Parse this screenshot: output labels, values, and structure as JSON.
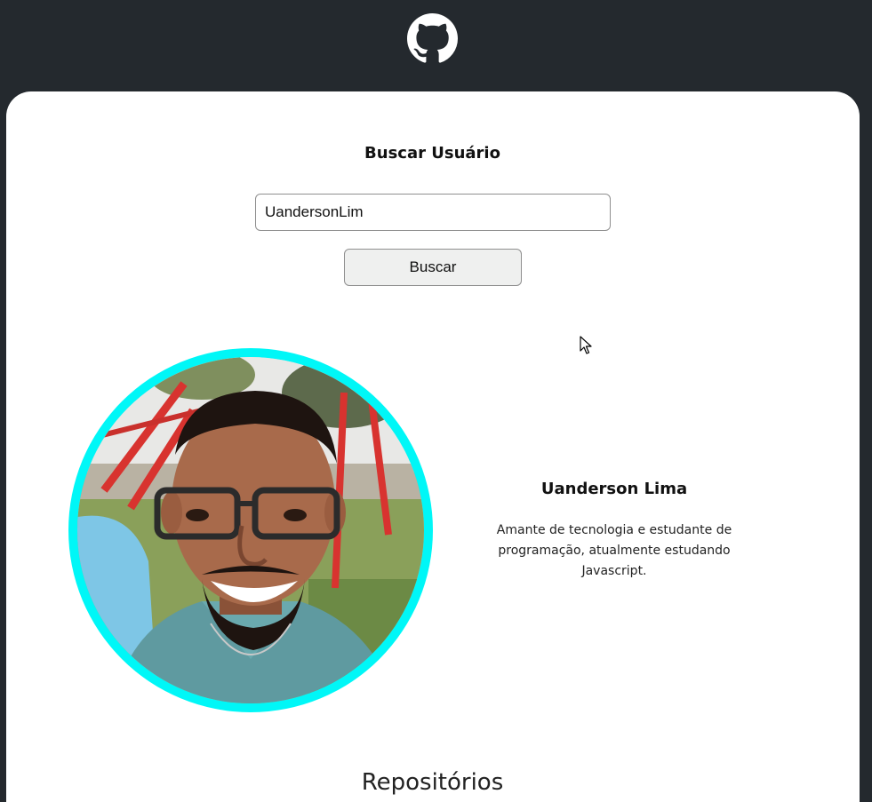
{
  "header": {
    "logo_icon": "github-icon",
    "background": "#24292e"
  },
  "search": {
    "title": "Buscar Usuário",
    "input_value": "UandersonLim",
    "button_label": "Buscar"
  },
  "profile": {
    "avatar_icon": "user-photo",
    "ring_color": "#00f7f7",
    "name": "Uanderson Lima",
    "bio": "Amante de tecnologia e estudante de programação, atualmente estudando Javascript."
  },
  "repositories": {
    "title": "Repositórios"
  }
}
